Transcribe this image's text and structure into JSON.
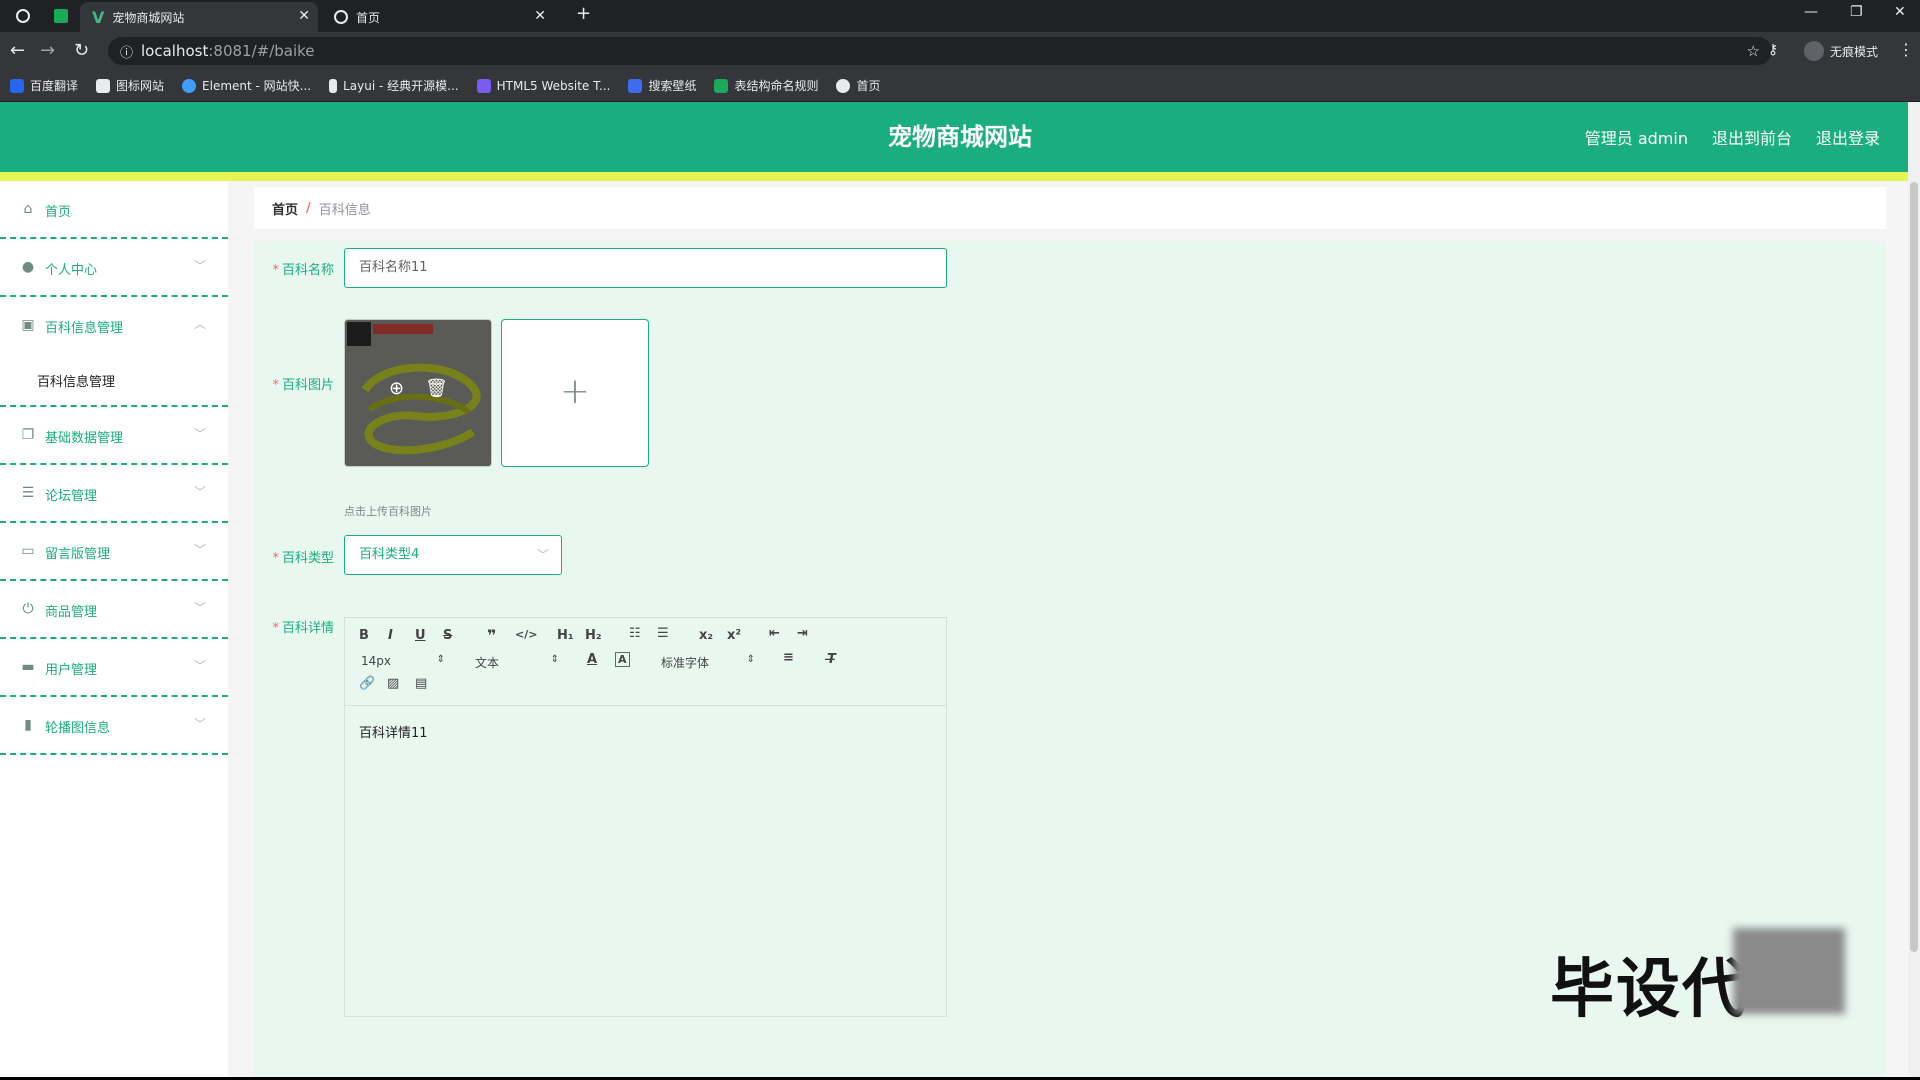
{
  "browser": {
    "tabs": [
      {
        "title": "宠物商城网站",
        "active": true
      },
      {
        "title": "首页",
        "active": false
      }
    ],
    "new_tab": "+",
    "url_host": "localhost",
    "url_path": ":8081/#/baike",
    "incognito_label": "无痕模式",
    "bookmarks": [
      {
        "label": "百度翻译",
        "color": "#2468f2"
      },
      {
        "label": "图标网站",
        "color": "#e8eaed"
      },
      {
        "label": "Element - 网站快...",
        "color": "#409eff"
      },
      {
        "label": "Layui - 经典开源模...",
        "color": "#e8eaed"
      },
      {
        "label": "HTML5 Website T...",
        "color": "#7b5cf0"
      },
      {
        "label": "搜索壁纸",
        "color": "#3d6cf0"
      },
      {
        "label": "表结构命名规则",
        "color": "#1aaa5a"
      },
      {
        "label": "首页",
        "color": "#e8eaed"
      }
    ]
  },
  "header": {
    "brand": "宠物商城网站",
    "admin": "管理员 admin",
    "to_front": "退出到前台",
    "logout": "退出登录",
    "accent": "#1aae7e",
    "stripe": "#e4f554"
  },
  "sidebar": {
    "items": [
      {
        "label": "首页",
        "icon": "home-icon"
      },
      {
        "label": "个人中心",
        "icon": "user-icon"
      },
      {
        "label": "百科信息管理",
        "icon": "book-icon"
      },
      {
        "label": "基础数据管理",
        "icon": "copy-icon"
      },
      {
        "label": "论坛管理",
        "icon": "sliders-icon"
      },
      {
        "label": "留言版管理",
        "icon": "message-icon"
      },
      {
        "label": "商品管理",
        "icon": "power-icon"
      },
      {
        "label": "用户管理",
        "icon": "briefcase-icon"
      },
      {
        "label": "轮播图信息",
        "icon": "bar-chart-icon"
      }
    ],
    "sub_item": "百科信息管理"
  },
  "breadcrumb": {
    "home": "首页",
    "sep": "/",
    "current": "百科信息"
  },
  "form": {
    "name_label": "百科名称",
    "name_value": "百科名称11",
    "image_label": "百科图片",
    "upload_tip": "点击上传百科图片",
    "type_label": "百科类型",
    "type_value": "百科类型4",
    "detail_label": "百科详情",
    "detail_value": "百科详情11",
    "required_mark": "*"
  },
  "editor": {
    "size": "14px",
    "heading": "文本",
    "font": "标准字体"
  },
  "watermark": "毕设代"
}
